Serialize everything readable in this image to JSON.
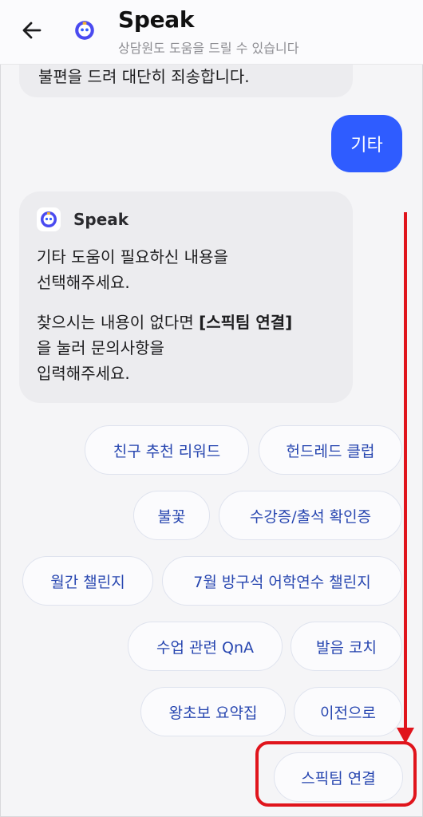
{
  "header": {
    "back_icon": "arrow-left-icon",
    "avatar_icon": "speak-bot-icon",
    "title": "Speak",
    "subtitle": "상담원도 도움을 드릴 수 있습니다"
  },
  "chat": {
    "previous_bot_text": "불편을 드려 대단히 죄송합니다.",
    "user_message": "기타",
    "bot": {
      "name": "Speak",
      "message_line1": "기타 도움이 필요하신 내용을",
      "message_line2": "선택해주세요.",
      "message2_part1": "찾으시는 내용이 없다면 ",
      "message2_bold": "[스픽팀 연결]",
      "message2_part2": "을 눌러 문의사항을",
      "message2_line3": "입력해주세요."
    }
  },
  "quick_replies": [
    "친구 추천 리워드",
    "헌드레드 클럽",
    "불꽃",
    "수강증/출석 확인증",
    "월간 챌린지",
    "7월 방구석 어학연수 챌린지",
    "수업 관련 QnA",
    "발음 코치",
    "왕초보 요약집",
    "이전으로",
    "스픽팀 연결"
  ],
  "colors": {
    "accent": "#2f5cff",
    "chip_text": "#2746b0",
    "annotation": "#e0141c",
    "bubble": "#ececef"
  }
}
